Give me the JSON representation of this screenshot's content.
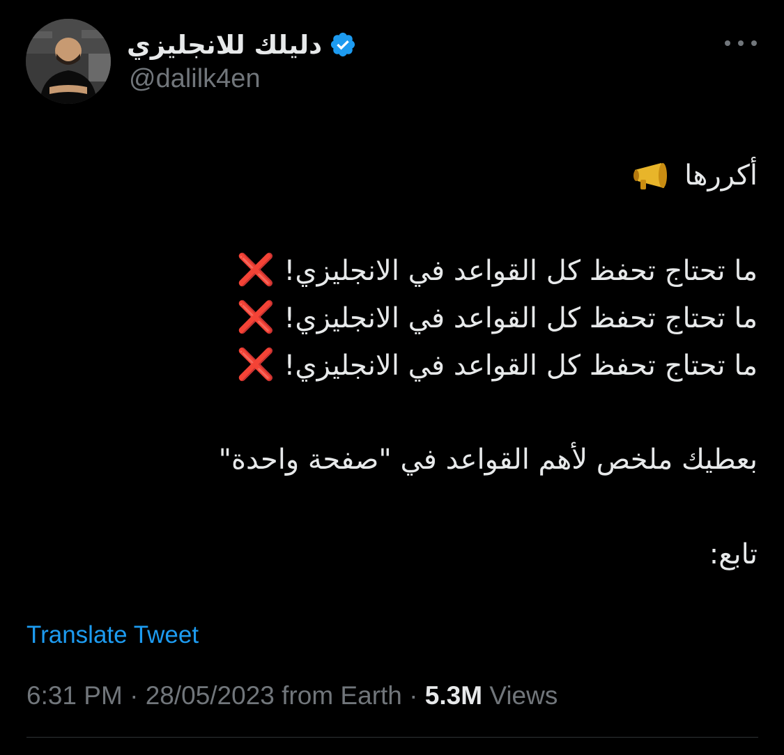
{
  "author": {
    "display_name": "دليلك للانجليزي",
    "handle": "@dalilk4en",
    "verified": true
  },
  "tweet": {
    "lines": [
      "أكررها",
      "",
      "ما تحتاج تحفظ كل القواعد في الانجليزي!",
      "ما تحتاج تحفظ كل القواعد في الانجليزي!",
      "ما تحتاج تحفظ كل القواعد في الانجليزي!",
      "",
      "بعطيك ملخص لأهم القواعد في \"صفحة واحدة\"",
      "",
      "تابع:"
    ],
    "cross_mark": "❌"
  },
  "translate_label": "Translate Tweet",
  "meta": {
    "time": "6:31 PM",
    "date": "28/05/2023",
    "source": "from Earth",
    "views_count": "5.3M",
    "views_label": "Views"
  },
  "icons": {
    "verified": "verified-badge-icon",
    "more": "more-dots-icon",
    "megaphone": "megaphone-icon",
    "cross": "cross-mark-icon"
  },
  "colors": {
    "background": "#000000",
    "text": "#e7e9ea",
    "secondary": "#71767b",
    "link": "#1d9bf0",
    "verified": "#1d9bf0",
    "cross": "#e0242e"
  }
}
